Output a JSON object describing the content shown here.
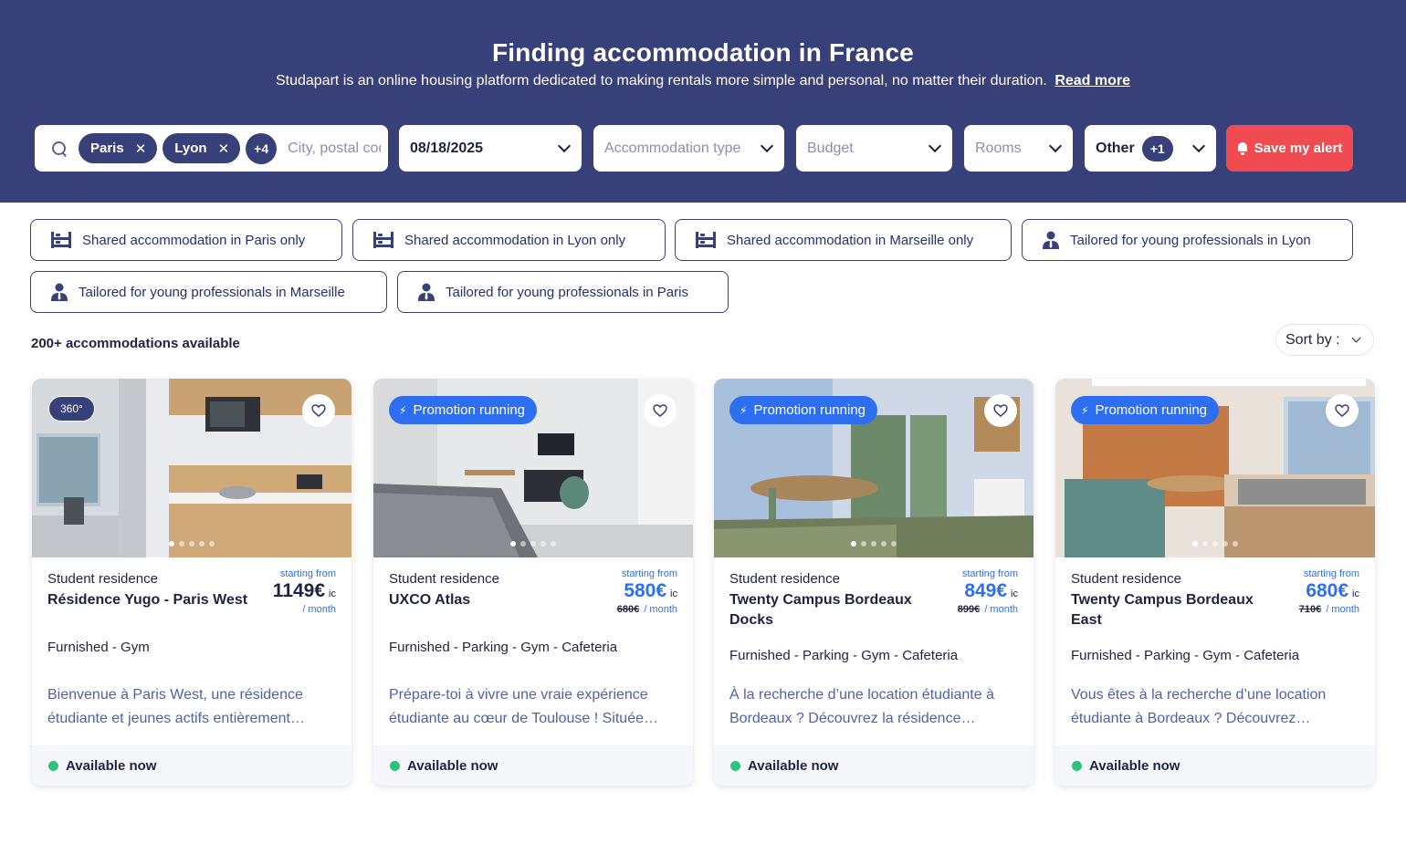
{
  "hero": {
    "title": "Finding accommodation in France",
    "subtitle": "Studapart is an online housing platform dedicated to making rentals more simple and personal, no matter their duration.",
    "read_more": "Read more"
  },
  "search": {
    "tags": [
      "Paris",
      "Lyon"
    ],
    "more_count": "+4",
    "placeholder": "City, postal code"
  },
  "filters": {
    "date": "08/18/2025",
    "type": "Accommodation type",
    "budget": "Budget",
    "rooms": "Rooms",
    "other": "Other",
    "other_count": "+1",
    "alert_button": "Save my alert"
  },
  "chips": [
    {
      "label": "Shared accommodation in Paris only",
      "icon": "bunk-bed-icon"
    },
    {
      "label": "Shared accommodation in Lyon only",
      "icon": "bunk-bed-icon"
    },
    {
      "label": "Shared accommodation in Marseille only",
      "icon": "bunk-bed-icon"
    },
    {
      "label": "Tailored for young professionals in Lyon",
      "icon": "professional-person-icon"
    },
    {
      "label": "Tailored for young professionals in Marseille",
      "icon": "professional-person-icon"
    },
    {
      "label": "Tailored for young professionals in Paris",
      "icon": "professional-person-icon"
    }
  ],
  "results": {
    "count": "200+ accommodations available",
    "sort": "Sort by :"
  },
  "cards": [
    {
      "badge": "360°",
      "kind": "Student residence",
      "name": "Résidence Yugo - Paris West",
      "from": "starting from",
      "price": "1149€",
      "ic": "ic",
      "old_price": "",
      "per": "/ month",
      "features": "Furnished - Gym",
      "description": "Bienvenue à Paris West, une résidence étudiante et jeunes actifs entièrement…",
      "availability": "Available now",
      "colors": {
        "price": "#1f2340"
      }
    },
    {
      "badge": "Promotion running",
      "kind": "Student residence",
      "name": "UXCO Atlas",
      "from": "starting from",
      "price": "580€",
      "ic": "ic",
      "old_price": "680€",
      "per": "/ month",
      "features": "Furnished - Parking - Gym - Cafeteria",
      "description": "Prépare-toi à vivre une vraie expérience étudiante au cœur de Toulouse ! Située…",
      "availability": "Available now",
      "colors": {
        "price": "#2d6ff0"
      }
    },
    {
      "badge": "Promotion running",
      "kind": "Student residence",
      "name": "Twenty Campus Bordeaux Docks",
      "from": "starting from",
      "price": "849€",
      "ic": "ic",
      "old_price": "899€",
      "per": "/ month",
      "features": "Furnished - Parking - Gym - Cafeteria",
      "description": "À la recherche d’une location étudiante à Bordeaux ? Découvrez la résidence…",
      "availability": "Available now",
      "colors": {
        "price": "#2d6ff0"
      }
    },
    {
      "badge": "Promotion running",
      "kind": "Student residence",
      "name": "Twenty Campus Bordeaux East",
      "from": "starting from",
      "price": "680€",
      "ic": "ic",
      "old_price": "710€",
      "per": "/ month",
      "features": "Furnished - Parking - Gym - Cafeteria",
      "description": "Vous êtes à la recherche d’une location étudiante à Bordeaux ? Découvrez…",
      "availability": "Available now",
      "colors": {
        "price": "#2d6ff0"
      }
    }
  ],
  "colors": {
    "header_bg": "#374078",
    "alert_red": "#ef4b50",
    "accent_blue": "#2d6ff0",
    "available_green": "#2fc27b"
  }
}
